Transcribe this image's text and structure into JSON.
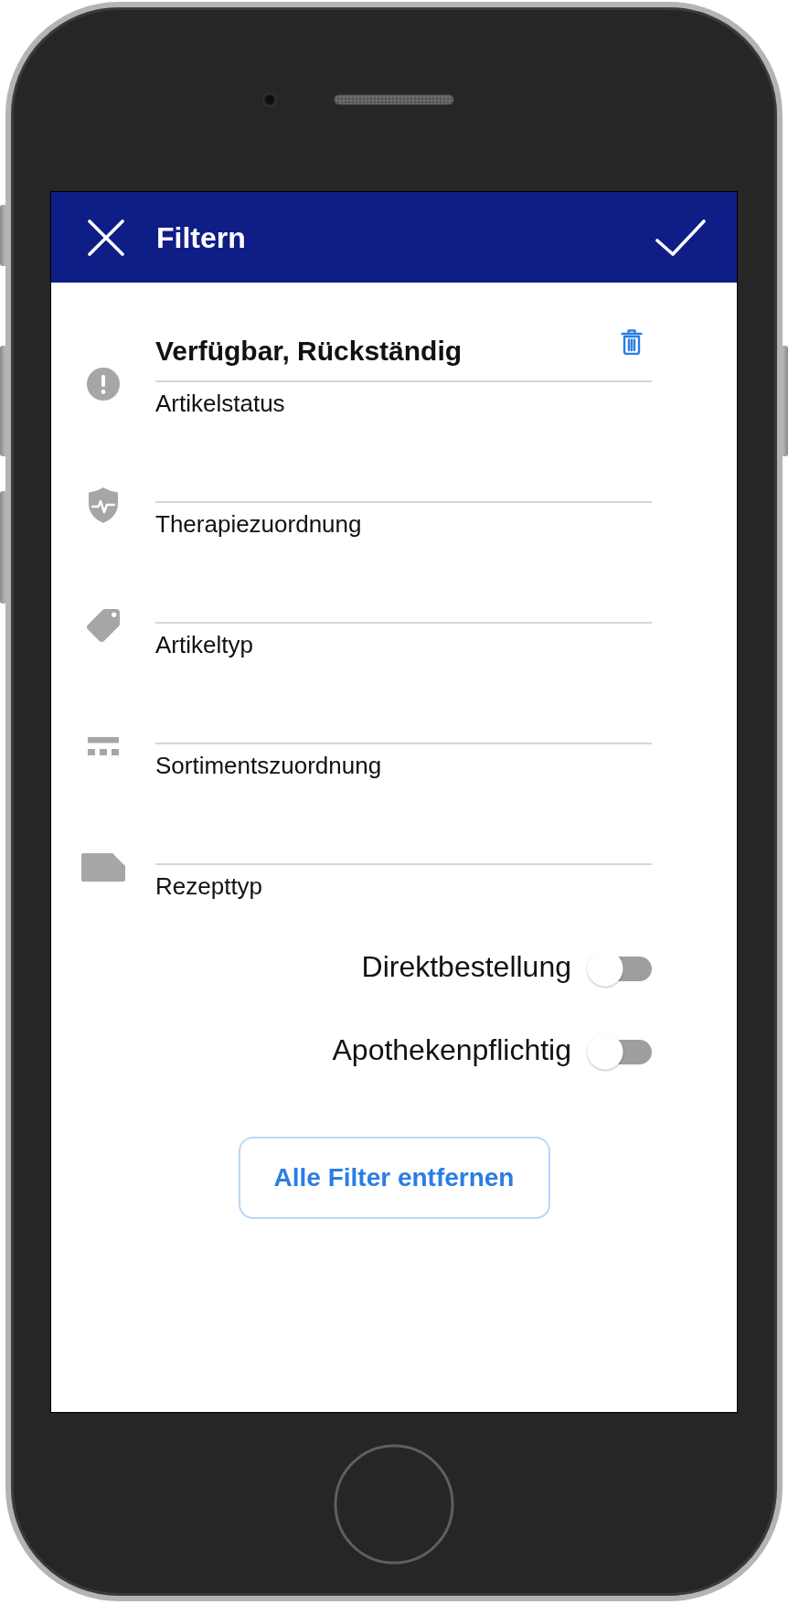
{
  "header": {
    "title": "Filtern"
  },
  "fields": [
    {
      "kind": "status",
      "value": "Verfügbar, Rückständig",
      "label": "Artikelstatus"
    },
    {
      "kind": "therapy",
      "label": "Therapiezuordnung"
    },
    {
      "kind": "type",
      "label": "Artikeltyp"
    },
    {
      "kind": "assortment",
      "label": "Sortimentszuordnung"
    },
    {
      "kind": "prescription",
      "label": "Rezepttyp"
    }
  ],
  "toggles": [
    {
      "label": "Direktbestellung",
      "on": false
    },
    {
      "label": "Apothekenpflichtig",
      "on": false
    }
  ],
  "reset_button": {
    "label": "Alle Filter entfernen"
  }
}
